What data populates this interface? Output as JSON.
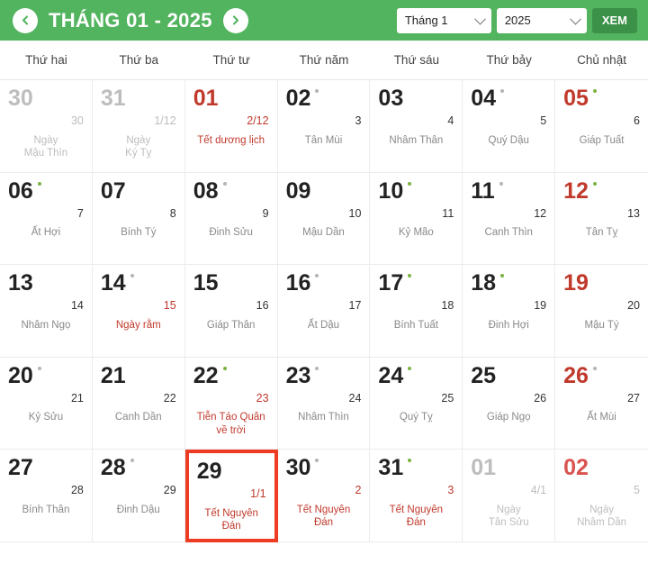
{
  "header": {
    "prev_label": "‹",
    "next_label": "›",
    "title": "THÁNG 01 - 2025",
    "month_select": {
      "value": "Tháng 1"
    },
    "year_select": {
      "value": "2025"
    },
    "view_button": "XEM",
    "bar_color": "#53b45f",
    "button_color": "#3a9147"
  },
  "weekdays": [
    "Thứ hai",
    "Thứ ba",
    "Thứ tư",
    "Thứ năm",
    "Thứ sáu",
    "Thứ bảy",
    "Chủ nhật"
  ],
  "colors": {
    "red": "#c0392b",
    "selected_border": "#ee3b24",
    "dot_green": "#7cb342",
    "dot_gray": "#b5b5b5",
    "muted": "#bdbdbd"
  },
  "days": [
    {
      "day": "30",
      "lunar": "30",
      "note": "Ngày\nMậu Thìn",
      "dot": "none",
      "out": true,
      "sunday": false,
      "holiday": false,
      "selected": false
    },
    {
      "day": "31",
      "lunar": "1/12",
      "note": "Ngày\nKý Tỵ",
      "dot": "none",
      "out": true,
      "sunday": false,
      "holiday": false,
      "selected": false
    },
    {
      "day": "01",
      "lunar": "2/12",
      "note": "Tết dương lịch",
      "dot": "none",
      "out": false,
      "sunday": false,
      "holiday": true,
      "selected": false
    },
    {
      "day": "02",
      "lunar": "3",
      "note": "Tân Mùi",
      "dot": "gray",
      "out": false,
      "sunday": false,
      "holiday": false,
      "selected": false
    },
    {
      "day": "03",
      "lunar": "4",
      "note": "Nhâm Thân",
      "dot": "none",
      "out": false,
      "sunday": false,
      "holiday": false,
      "selected": false
    },
    {
      "day": "04",
      "lunar": "5",
      "note": "Quý Dậu",
      "dot": "gray",
      "out": false,
      "sunday": false,
      "holiday": false,
      "selected": false
    },
    {
      "day": "05",
      "lunar": "6",
      "note": "Giáp Tuất",
      "dot": "green",
      "out": false,
      "sunday": true,
      "holiday": false,
      "selected": false
    },
    {
      "day": "06",
      "lunar": "7",
      "note": "Ất Hợi",
      "dot": "green",
      "out": false,
      "sunday": false,
      "holiday": false,
      "selected": false
    },
    {
      "day": "07",
      "lunar": "8",
      "note": "Bính Tý",
      "dot": "none",
      "out": false,
      "sunday": false,
      "holiday": false,
      "selected": false
    },
    {
      "day": "08",
      "lunar": "9",
      "note": "Đinh Sửu",
      "dot": "gray",
      "out": false,
      "sunday": false,
      "holiday": false,
      "selected": false
    },
    {
      "day": "09",
      "lunar": "10",
      "note": "Mậu Dần",
      "dot": "none",
      "out": false,
      "sunday": false,
      "holiday": false,
      "selected": false
    },
    {
      "day": "10",
      "lunar": "11",
      "note": "Kỷ Mão",
      "dot": "green",
      "out": false,
      "sunday": false,
      "holiday": false,
      "selected": false
    },
    {
      "day": "11",
      "lunar": "12",
      "note": "Canh Thìn",
      "dot": "gray",
      "out": false,
      "sunday": false,
      "holiday": false,
      "selected": false
    },
    {
      "day": "12",
      "lunar": "13",
      "note": "Tân Tỵ",
      "dot": "green",
      "out": false,
      "sunday": true,
      "holiday": false,
      "selected": false
    },
    {
      "day": "13",
      "lunar": "14",
      "note": "Nhâm Ngọ",
      "dot": "none",
      "out": false,
      "sunday": false,
      "holiday": false,
      "selected": false
    },
    {
      "day": "14",
      "lunar": "15",
      "note": "Ngày rằm",
      "dot": "gray",
      "out": false,
      "sunday": false,
      "holiday": false,
      "selected": false,
      "red_lunar": true,
      "red_note": true
    },
    {
      "day": "15",
      "lunar": "16",
      "note": "Giáp Thân",
      "dot": "none",
      "out": false,
      "sunday": false,
      "holiday": false,
      "selected": false
    },
    {
      "day": "16",
      "lunar": "17",
      "note": "Ất Dậu",
      "dot": "gray",
      "out": false,
      "sunday": false,
      "holiday": false,
      "selected": false
    },
    {
      "day": "17",
      "lunar": "18",
      "note": "Bính Tuất",
      "dot": "green",
      "out": false,
      "sunday": false,
      "holiday": false,
      "selected": false
    },
    {
      "day": "18",
      "lunar": "19",
      "note": "Đinh Hợi",
      "dot": "green",
      "out": false,
      "sunday": false,
      "holiday": false,
      "selected": false
    },
    {
      "day": "19",
      "lunar": "20",
      "note": "Mậu Tý",
      "dot": "none",
      "out": false,
      "sunday": true,
      "holiday": false,
      "selected": false
    },
    {
      "day": "20",
      "lunar": "21",
      "note": "Kỷ Sửu",
      "dot": "gray",
      "out": false,
      "sunday": false,
      "holiday": false,
      "selected": false
    },
    {
      "day": "21",
      "lunar": "22",
      "note": "Canh Dần",
      "dot": "none",
      "out": false,
      "sunday": false,
      "holiday": false,
      "selected": false
    },
    {
      "day": "22",
      "lunar": "23",
      "note": "Tiễn Táo Quân\nvề trời",
      "dot": "green",
      "out": false,
      "sunday": false,
      "holiday": false,
      "selected": false,
      "red_lunar": true,
      "red_note": true
    },
    {
      "day": "23",
      "lunar": "24",
      "note": "Nhâm Thìn",
      "dot": "gray",
      "out": false,
      "sunday": false,
      "holiday": false,
      "selected": false
    },
    {
      "day": "24",
      "lunar": "25",
      "note": "Quý Tỵ",
      "dot": "green",
      "out": false,
      "sunday": false,
      "holiday": false,
      "selected": false
    },
    {
      "day": "25",
      "lunar": "26",
      "note": "Giáp Ngọ",
      "dot": "none",
      "out": false,
      "sunday": false,
      "holiday": false,
      "selected": false
    },
    {
      "day": "26",
      "lunar": "27",
      "note": "Ất Mùi",
      "dot": "gray",
      "out": false,
      "sunday": true,
      "holiday": false,
      "selected": false
    },
    {
      "day": "27",
      "lunar": "28",
      "note": "Bính Thân",
      "dot": "none",
      "out": false,
      "sunday": false,
      "holiday": false,
      "selected": false
    },
    {
      "day": "28",
      "lunar": "29",
      "note": "Đinh Dậu",
      "dot": "gray",
      "out": false,
      "sunday": false,
      "holiday": false,
      "selected": false
    },
    {
      "day": "29",
      "lunar": "1/1",
      "note": "Tết Nguyên\nĐán",
      "dot": "none",
      "out": false,
      "sunday": false,
      "holiday": false,
      "selected": true,
      "red_lunar": true,
      "red_note": true
    },
    {
      "day": "30",
      "lunar": "2",
      "note": "Tết Nguyên\nĐán",
      "dot": "gray",
      "out": false,
      "sunday": false,
      "holiday": false,
      "selected": false,
      "red_lunar": true,
      "red_note": true
    },
    {
      "day": "31",
      "lunar": "3",
      "note": "Tết Nguyên\nĐán",
      "dot": "green",
      "out": false,
      "sunday": false,
      "holiday": false,
      "selected": false,
      "red_lunar": true,
      "red_note": true
    },
    {
      "day": "01",
      "lunar": "4/1",
      "note": "Ngày\nTân Sửu",
      "dot": "none",
      "out": true,
      "sunday": false,
      "holiday": false,
      "selected": false
    },
    {
      "day": "02",
      "lunar": "5",
      "note": "Ngày\nNhâm Dần",
      "dot": "none",
      "out": true,
      "sunday": true,
      "holiday": false,
      "selected": false
    }
  ]
}
